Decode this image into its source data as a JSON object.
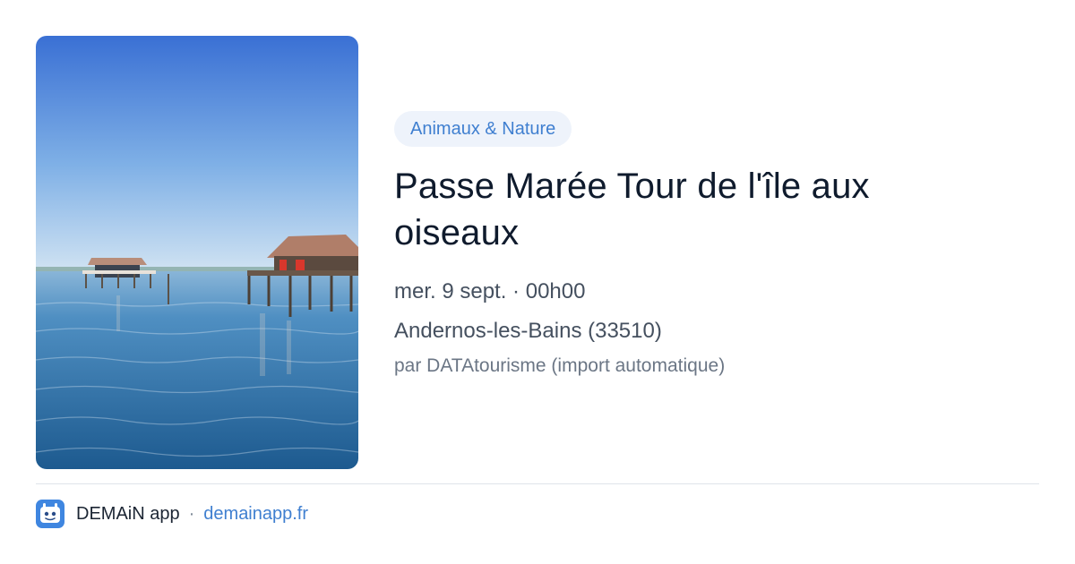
{
  "card": {
    "category": "Animaux & Nature",
    "title": "Passe Marée Tour de l'île aux oiseaux",
    "date": "mer. 9 sept. · 00h00",
    "location": "Andernos-les-Bains (33510)",
    "source": "par DATAtourisme (import automatique)",
    "image": {
      "subject": "stilt houses over calm blue water",
      "sky_top": "#3f76d6",
      "sky_bottom": "#c7dcf0",
      "water": "#2f6ea6"
    }
  },
  "footer": {
    "app_icon": "demain-app-icon",
    "app_name": "DEMAiN app",
    "separator": "·",
    "domain": "demainapp.fr"
  },
  "colors": {
    "accent": "#3f7fd0",
    "tag_background": "#eef3fb",
    "text_primary": "#0f1b2d",
    "text_secondary": "#45505f"
  }
}
